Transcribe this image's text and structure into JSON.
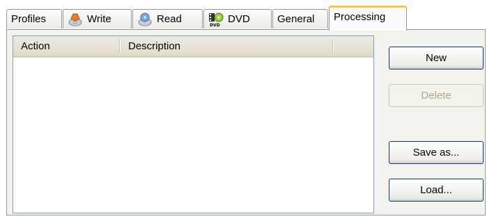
{
  "tabs": [
    {
      "label": "Profiles",
      "icon": null,
      "active": false
    },
    {
      "label": "Write",
      "icon": "write-disc-icon",
      "active": false
    },
    {
      "label": "Read",
      "icon": "read-disc-icon",
      "active": false
    },
    {
      "label": "DVD",
      "icon": "dvd-icon",
      "active": false
    },
    {
      "label": "General",
      "icon": null,
      "active": false
    },
    {
      "label": "Processing",
      "icon": null,
      "active": true
    }
  ],
  "list": {
    "columns": [
      "Action",
      "Description"
    ],
    "rows": []
  },
  "buttons": {
    "new_label": "New",
    "delete_label": "Delete",
    "save_as_label": "Save as...",
    "load_label": "Load..."
  },
  "colors": {
    "active_tab_accent": "#ffc83c",
    "button_border": "#003c74",
    "panel_bg": "#f4f3ee"
  }
}
